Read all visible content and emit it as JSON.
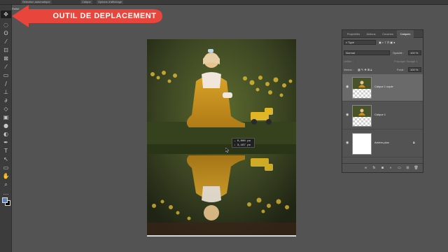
{
  "optionbar": {
    "items": [
      "Sélection automatique",
      "Calque",
      "Options d'affichage"
    ]
  },
  "document": {
    "tab": "Reflet"
  },
  "callout": {
    "label": "OUTIL DE DEPLACEMENT",
    "color": "#e8453c"
  },
  "toolbar": {
    "tools": [
      {
        "icon": "move-icon",
        "glyph": "✥"
      },
      {
        "icon": "marquee-icon",
        "glyph": "◌"
      },
      {
        "icon": "lasso-icon",
        "glyph": "ʘ"
      },
      {
        "icon": "magic-wand-icon",
        "glyph": "⁄"
      },
      {
        "icon": "crop-icon",
        "glyph": "⊡"
      },
      {
        "icon": "frame-icon",
        "glyph": "⊠"
      },
      {
        "icon": "eyedropper-icon",
        "glyph": "⁄"
      },
      {
        "icon": "healing-brush-icon",
        "glyph": "▭"
      },
      {
        "icon": "brush-icon",
        "glyph": "∕"
      },
      {
        "icon": "clone-stamp-icon",
        "glyph": "⊥"
      },
      {
        "icon": "history-brush-icon",
        "glyph": "∂"
      },
      {
        "icon": "eraser-icon",
        "glyph": "◇"
      },
      {
        "icon": "gradient-icon",
        "glyph": "▣"
      },
      {
        "icon": "blur-icon",
        "glyph": "●"
      },
      {
        "icon": "dodge-icon",
        "glyph": "◐"
      },
      {
        "icon": "pen-icon",
        "glyph": "✒"
      },
      {
        "icon": "type-icon",
        "glyph": "T"
      },
      {
        "icon": "path-selection-icon",
        "glyph": "↖"
      },
      {
        "icon": "shape-icon",
        "glyph": "▭"
      },
      {
        "icon": "hand-icon",
        "glyph": "✋"
      },
      {
        "icon": "zoom-icon",
        "glyph": "⌕"
      },
      {
        "icon": "more-tools-icon",
        "glyph": "…"
      }
    ]
  },
  "readout": {
    "line1": "→ 0,000 po",
    "line2": "↓ 3,167 po"
  },
  "panel": {
    "tabs": [
      "Propriétés",
      "Actions",
      "Couches",
      "Calques"
    ],
    "active_tab": "Calques",
    "filter_label": "Type",
    "blend_mode": "Normal",
    "opacity_label": "Opacité :",
    "opacity_value": "100 %",
    "unify_label": "Unifier :",
    "propagate_label": "Propager l'image 1",
    "lock_label": "Verrou :",
    "fill_label": "Fond :",
    "fill_value": "100 %",
    "layers": [
      {
        "name": "Calque 1 copie",
        "selected": true,
        "thumb": "photo-transparent"
      },
      {
        "name": "Calque 1",
        "selected": false,
        "thumb": "photo-transparent"
      },
      {
        "name": "Arrière-plan",
        "selected": false,
        "thumb": "white",
        "locked": true
      }
    ],
    "footer_icons": [
      "link-icon",
      "fx-icon",
      "mask-icon",
      "adjustment-icon",
      "group-icon",
      "new-layer-icon",
      "trash-icon"
    ]
  }
}
